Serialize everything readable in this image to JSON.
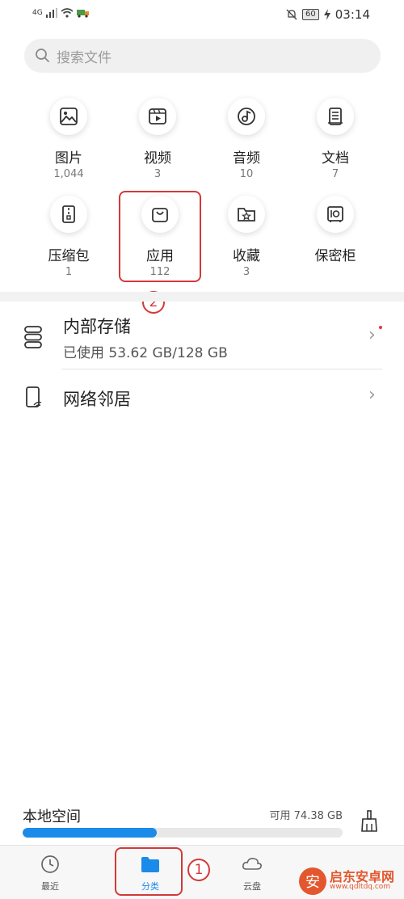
{
  "status_bar": {
    "network": "4G",
    "battery": "60",
    "time": "03:14"
  },
  "search": {
    "placeholder": "搜索文件"
  },
  "categories": [
    {
      "label": "图片",
      "count": "1,044",
      "icon": "image-icon"
    },
    {
      "label": "视频",
      "count": "3",
      "icon": "video-icon"
    },
    {
      "label": "音频",
      "count": "10",
      "icon": "music-icon"
    },
    {
      "label": "文档",
      "count": "7",
      "icon": "document-icon"
    },
    {
      "label": "压缩包",
      "count": "1",
      "icon": "zip-icon"
    },
    {
      "label": "应用",
      "count": "112",
      "icon": "shopping-bag-icon"
    },
    {
      "label": "收藏",
      "count": "3",
      "icon": "star-folder-icon"
    },
    {
      "label": "保密柜",
      "count": "",
      "icon": "safe-icon"
    }
  ],
  "annotations": {
    "step1": "1",
    "step2": "2"
  },
  "storage": {
    "internal": {
      "title": "内部存储",
      "usage": "已使用 53.62 GB/128 GB",
      "icon": "storage-icon"
    },
    "network": {
      "title": "网络邻居",
      "icon": "network-device-icon"
    }
  },
  "local_space": {
    "label": "本地空间",
    "available": "可用 74.38 GB",
    "used_fraction": 0.4189
  },
  "bottom_nav": [
    {
      "label": "最近",
      "icon": "clock-icon",
      "active": false
    },
    {
      "label": "分类",
      "icon": "folder-icon",
      "active": true
    },
    {
      "label": "云盘",
      "icon": "cloud-icon",
      "active": false
    }
  ],
  "watermark": {
    "title": "启东安卓网",
    "url": "www.qdltdq.com"
  },
  "colors": {
    "accent": "#1b8bea",
    "annotation": "#d23a3a",
    "watermark": "#e4572e"
  }
}
